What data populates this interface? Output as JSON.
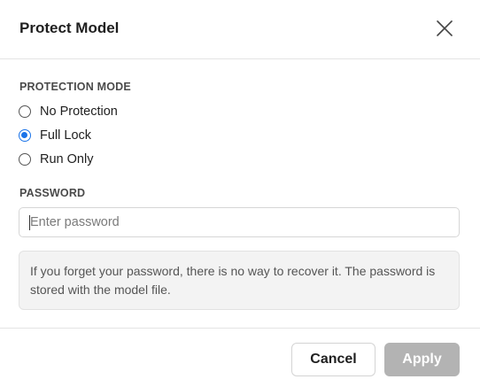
{
  "dialog": {
    "title": "Protect Model",
    "close_icon": "close-icon"
  },
  "protection": {
    "label": "PROTECTION MODE",
    "options": [
      {
        "label": "No Protection",
        "checked": false
      },
      {
        "label": "Full Lock",
        "checked": true
      },
      {
        "label": "Run Only",
        "checked": false
      }
    ],
    "selected": "Full Lock",
    "accent_color": "#1a73e8"
  },
  "password": {
    "label": "PASSWORD",
    "placeholder": "Enter password",
    "value": ""
  },
  "info": {
    "text": "If you forget your password, there is no way to recover it. The password is stored with the model file."
  },
  "footer": {
    "cancel_label": "Cancel",
    "apply_label": "Apply",
    "apply_enabled": false,
    "apply_color": "#b3b3b3"
  }
}
